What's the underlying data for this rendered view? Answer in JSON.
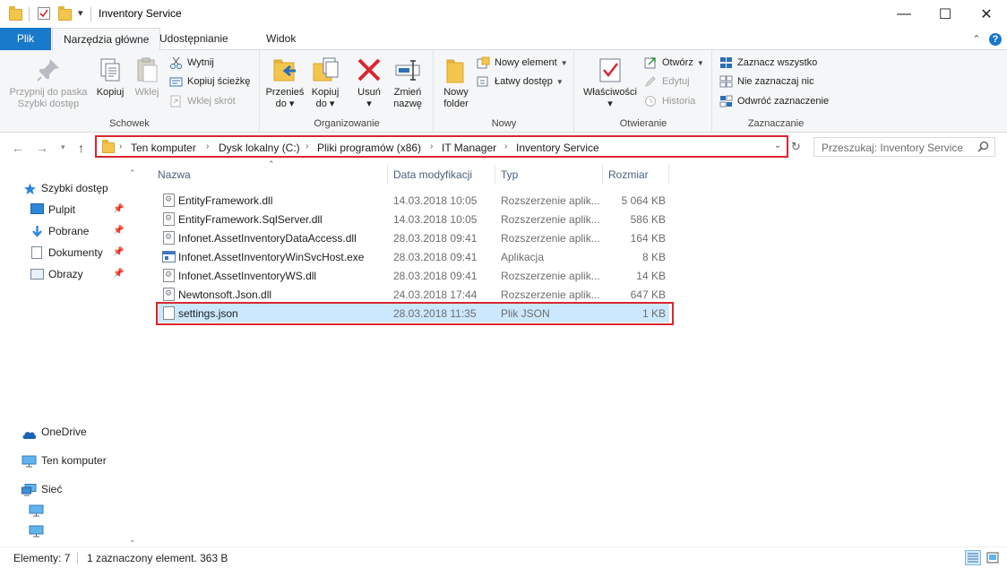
{
  "window": {
    "title": "Inventory Service",
    "qat_dropdown": "▾",
    "controls": {
      "minimize": "—",
      "maximize": "☐",
      "close": "✕"
    }
  },
  "ribbon": {
    "tabs": [
      "Plik",
      "Narzędzia główne",
      "Udostępnianie",
      "Widok"
    ],
    "collapse_glyph": "⌃",
    "help_glyph": "?",
    "groups": {
      "clipboard": {
        "label": "Schowek",
        "pin": "Przypnij do paska Szybki dostęp",
        "pin_l1": "Przypnij do paska",
        "pin_l2": "Szybki dostęp",
        "copy": "Kopiuj",
        "paste": "Wklej",
        "cut": "Wytnij",
        "copy_path": "Kopiuj ścieżkę",
        "paste_shortcut": "Wklej skrót"
      },
      "organize": {
        "label": "Organizowanie",
        "move_l1": "Przenieś",
        "move_l2": "do ▾",
        "copyto_l1": "Kopiuj",
        "copyto_l2": "do ▾",
        "delete_l1": "Usuń",
        "delete_l2": "▾",
        "rename_l1": "Zmień",
        "rename_l2": "nazwę"
      },
      "new": {
        "label": "Nowy",
        "folder_l1": "Nowy",
        "folder_l2": "folder",
        "new_item": "Nowy element",
        "easy_access": "Łatwy dostęp"
      },
      "open": {
        "label": "Otwieranie",
        "props_l1": "Właściwości",
        "props_l2": "▾",
        "open": "Otwórz",
        "edit": "Edytuj",
        "history": "Historia"
      },
      "select": {
        "label": "Zaznaczanie",
        "select_all": "Zaznacz wszystko",
        "select_none": "Nie zaznaczaj nic",
        "invert": "Odwróć zaznaczenie"
      }
    }
  },
  "address": {
    "crumbs": [
      "Ten komputer",
      "Dysk lokalny (C:)",
      "Pliki programów (x86)",
      "IT Manager",
      "Inventory Service"
    ],
    "search_placeholder": "Przeszukaj: Inventory Service"
  },
  "nav": {
    "quick_access": "Szybki dostęp",
    "items": [
      "Pulpit",
      "Pobrane",
      "Dokumenty",
      "Obrazy"
    ],
    "onedrive": "OneDrive",
    "this_pc": "Ten komputer",
    "network": "Sieć"
  },
  "files": {
    "columns": [
      "Nazwa",
      "Data modyfikacji",
      "Typ",
      "Rozmiar"
    ],
    "rows": [
      {
        "name": "EntityFramework.dll",
        "date": "14.03.2018 10:05",
        "type": "Rozszerzenie aplik...",
        "size": "5 064 KB"
      },
      {
        "name": "EntityFramework.SqlServer.dll",
        "date": "14.03.2018 10:05",
        "type": "Rozszerzenie aplik...",
        "size": "586 KB"
      },
      {
        "name": "Infonet.AssetInventoryDataAccess.dll",
        "date": "28.03.2018 09:41",
        "type": "Rozszerzenie aplik...",
        "size": "164 KB"
      },
      {
        "name": "Infonet.AssetInventoryWinSvcHost.exe",
        "date": "28.03.2018 09:41",
        "type": "Aplikacja",
        "size": "8 KB"
      },
      {
        "name": "Infonet.AssetInventoryWS.dll",
        "date": "28.03.2018 09:41",
        "type": "Rozszerzenie aplik...",
        "size": "14 KB"
      },
      {
        "name": "Newtonsoft.Json.dll",
        "date": "24.03.2018 17:44",
        "type": "Rozszerzenie aplik...",
        "size": "647 KB"
      },
      {
        "name": "settings.json",
        "date": "28.03.2018 11:35",
        "type": "Plik JSON",
        "size": "1 KB"
      }
    ]
  },
  "status": {
    "count": "Elementy: 7",
    "selected": "1 zaznaczony element. 363 B"
  }
}
